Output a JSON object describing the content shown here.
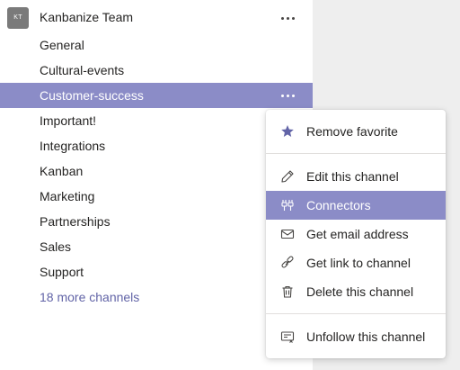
{
  "team": {
    "avatar_initials": "KT",
    "name": "Kanbanize Team"
  },
  "channels": [
    {
      "label": "General"
    },
    {
      "label": "Cultural-events"
    },
    {
      "label": "Customer-success"
    },
    {
      "label": "Important!"
    },
    {
      "label": "Integrations"
    },
    {
      "label": "Kanban"
    },
    {
      "label": "Marketing"
    },
    {
      "label": "Partnerships"
    },
    {
      "label": "Sales"
    },
    {
      "label": "Support"
    }
  ],
  "more_channels_label": "18 more channels",
  "context_menu": {
    "items": [
      {
        "label": "Remove favorite",
        "icon": "star-icon"
      },
      {
        "label": "Edit this channel",
        "icon": "pencil-icon"
      },
      {
        "label": "Connectors",
        "icon": "connectors-icon"
      },
      {
        "label": "Get email address",
        "icon": "mail-icon"
      },
      {
        "label": "Get link to channel",
        "icon": "link-icon"
      },
      {
        "label": "Delete this channel",
        "icon": "trash-icon"
      },
      {
        "label": "Unfollow this channel",
        "icon": "unfollow-icon"
      }
    ]
  },
  "colors": {
    "accent": "#6264a7",
    "selected_background": "#8b8cc7",
    "sidebar_background": "#ffffff",
    "page_background": "#eeeeee"
  }
}
